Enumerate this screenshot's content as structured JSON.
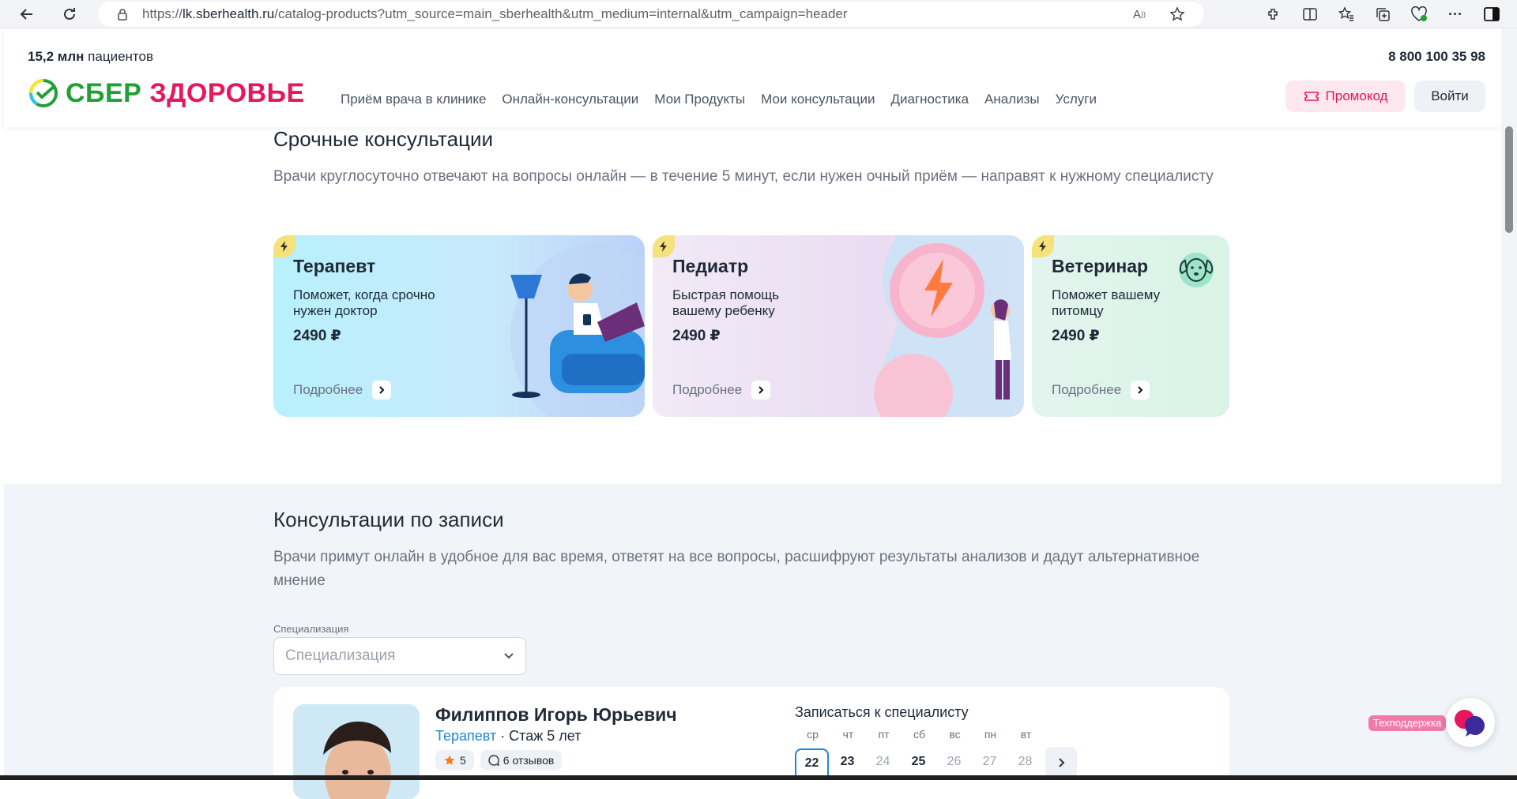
{
  "browser": {
    "url_prefix": "https://",
    "url_host": "lk.sberhealth.ru",
    "url_path": "/catalog-products?utm_source=main_sberhealth&utm_medium=internal&utm_campaign=header"
  },
  "header": {
    "patients_count": "15,2 млн",
    "patients_label": " пациентов",
    "phone": "8 800 100 35 98",
    "logo_sber": "СБЕР",
    "logo_zdr": "ЗДОРОВЬЕ",
    "nav": [
      "Приём врача в клинике",
      "Онлайн-консультации",
      "Мои Продукты",
      "Мои консультации",
      "Диагностика",
      "Анализы",
      "Услуги"
    ],
    "promo_label": "Промокод",
    "login_label": "Войти"
  },
  "urgent": {
    "title": "Срочные консультации",
    "lead": "Врачи круглосуточно отвечают на вопросы онлайн — в течение 5 минут, если нужен очный приём — направят к нужному специалисту",
    "cards": [
      {
        "title": "Терапевт",
        "desc": "Поможет, когда срочно нужен доктор",
        "price": "2490 ₽",
        "more": "Подробнее"
      },
      {
        "title": "Педиатр",
        "desc": "Быстрая помощь вашему ребенку",
        "price": "2490 ₽",
        "more": "Подробнее"
      },
      {
        "title": "Ветеринар",
        "desc": "Поможет вашему питомцу",
        "price": "2490 ₽",
        "more": "Подробнее"
      }
    ]
  },
  "scheduled": {
    "title": "Консультации по записи",
    "lead": "Врачи примут онлайн в удобное для вас время, ответят на все вопросы, расшифруют результаты анализов и дадут альтернативное мнение",
    "filter_label": "Специализация",
    "filter_placeholder": "Специализация",
    "doctor": {
      "name": "Филиппов Игорь Юрьевич",
      "specialty": "Терапевт",
      "experience": " · Стаж 5 лет",
      "rating": "5",
      "reviews": "6 отзывов",
      "book_title": "Записаться к специалисту",
      "days": [
        {
          "dow": "ср",
          "num": "22"
        },
        {
          "dow": "чт",
          "num": "23"
        },
        {
          "dow": "пт",
          "num": "24"
        },
        {
          "dow": "сб",
          "num": "25"
        },
        {
          "dow": "вс",
          "num": "26"
        },
        {
          "dow": "пн",
          "num": "27"
        },
        {
          "dow": "вт",
          "num": "28"
        }
      ]
    }
  },
  "support_label": "Техподдержка",
  "colors": {
    "sber_green": "#21a038",
    "zdr_pink": "#e6175c",
    "accent_blue": "#1f86d6"
  }
}
